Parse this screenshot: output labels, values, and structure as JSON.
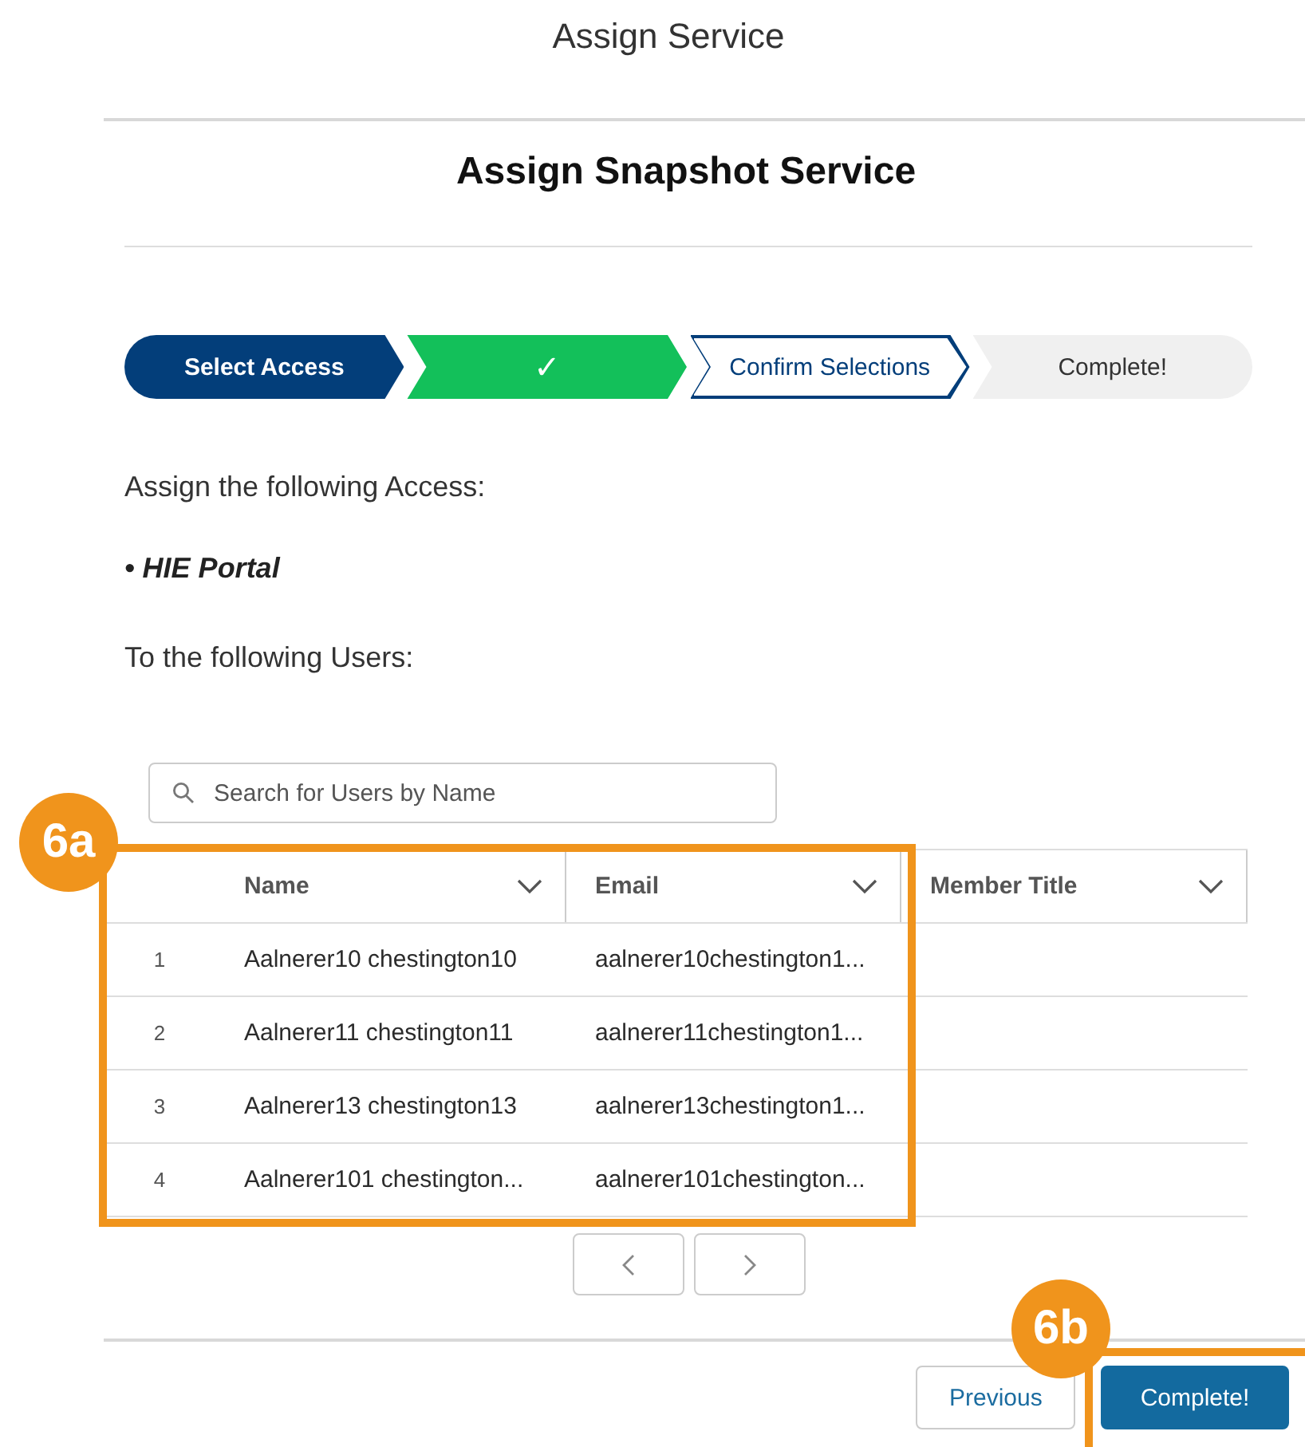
{
  "window": {
    "title": "Assign Service"
  },
  "heading": "Assign Snapshot Service",
  "path": [
    {
      "label": "Select Access",
      "kind": "active"
    },
    {
      "label": "✓",
      "kind": "complete"
    },
    {
      "label": "Confirm Selections",
      "kind": "current"
    },
    {
      "label": "Complete!",
      "kind": "incomplete"
    }
  ],
  "intro": "Assign the following Access:",
  "access_items": [
    "• HIE Portal"
  ],
  "users_label": "To the following Users:",
  "search": {
    "placeholder": "Search for Users by Name"
  },
  "table": {
    "columns": [
      "Name",
      "Email",
      "Member Title"
    ],
    "rows": [
      {
        "number": "1",
        "name": "Aalnerer10 chestington10",
        "email": "aalnerer10chestington1..."
      },
      {
        "number": "2",
        "name": "Aalnerer11 chestington11",
        "email": "aalnerer11chestington1..."
      },
      {
        "number": "3",
        "name": "Aalnerer13 chestington13",
        "email": "aalnerer13chestington1..."
      },
      {
        "number": "4",
        "name": "Aalnerer101 chestington...",
        "email": "aalnerer101chestington..."
      }
    ]
  },
  "footer": {
    "buttons": [
      {
        "label": "Previous",
        "kind": "neutral"
      },
      {
        "label": "Complete!",
        "kind": "brand"
      }
    ]
  },
  "annotations": [
    {
      "label": "6a"
    },
    {
      "label": "6b"
    }
  ]
}
